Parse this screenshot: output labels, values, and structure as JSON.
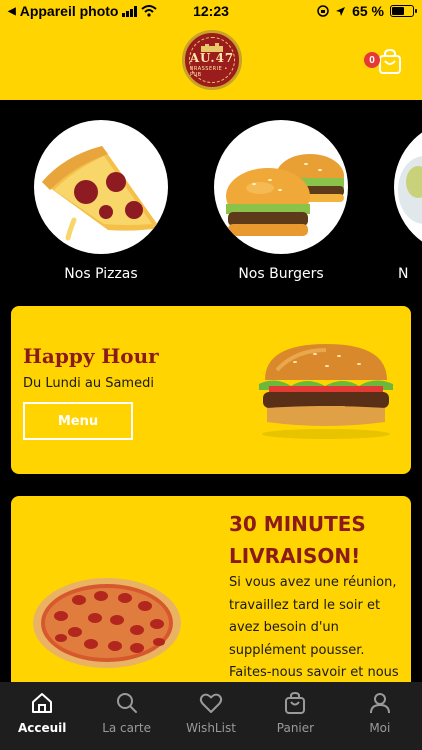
{
  "status_bar": {
    "carrier": "Appareil photo",
    "time": "12:23",
    "battery": "65 %",
    "battery_level": 0.65
  },
  "header": {
    "logo_text": "AU.47",
    "logo_subtext": "BRASSERIE • PUB",
    "cart_count": "0"
  },
  "categories": [
    {
      "label": "Nos Pizzas"
    },
    {
      "label": "Nos Burgers"
    },
    {
      "label": "N"
    }
  ],
  "happy_hour": {
    "title": "Happy Hour",
    "subtitle": "Du Lundi au Samedi",
    "button_label": "Menu"
  },
  "livraison": {
    "title": "30 MINUTES LIVRAISON!",
    "text": "Si vous avez une réunion, travaillez tard le soir et avez besoin d'un supplément pousser. Faites-nous savoir et nous y serons"
  },
  "bottom_nav": [
    {
      "label": "Acceuil",
      "icon": "home-icon"
    },
    {
      "label": "La carte",
      "icon": "search-icon"
    },
    {
      "label": "WishList",
      "icon": "heart-icon"
    },
    {
      "label": "Panier",
      "icon": "bag-icon"
    },
    {
      "label": "Moi",
      "icon": "user-icon"
    }
  ],
  "colors": {
    "accent": "#FFD400",
    "brand_red": "#8B1A1A",
    "badge": "#E53935",
    "nav_bg": "#1e1e1e"
  }
}
